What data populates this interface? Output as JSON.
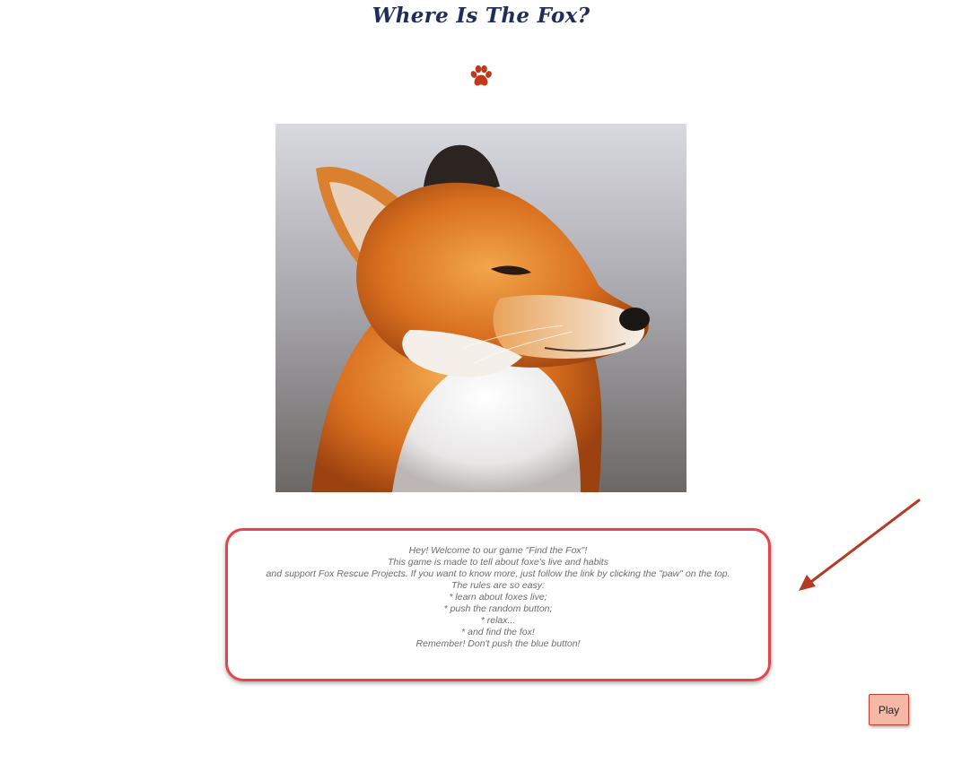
{
  "header": {
    "title": "Where Is The Fox?",
    "paw_icon": "paw-icon",
    "paw_color": "#c0391b",
    "title_color": "#1f2d5a"
  },
  "hero": {
    "subject": "fox-photo"
  },
  "info": {
    "lines": [
      "Hey! Welcome to our game \"Find the Fox\"!",
      "This game is made to tell about foxe's live and habits",
      "and support Fox Rescue Projects. If you want to know more, just follow the link by clicking the \"paw\" on the top.",
      "The rules are so easy:",
      "* learn about foxes live;",
      "* push the random button;",
      "* relax...",
      "* and find the fox!",
      "Remember! Don't push the blue button!"
    ],
    "border_color": "#e4454a"
  },
  "annotation": {
    "arrow_color": "#b43a22"
  },
  "actions": {
    "play_label": "Play",
    "play_color": "#f7b7a7"
  }
}
